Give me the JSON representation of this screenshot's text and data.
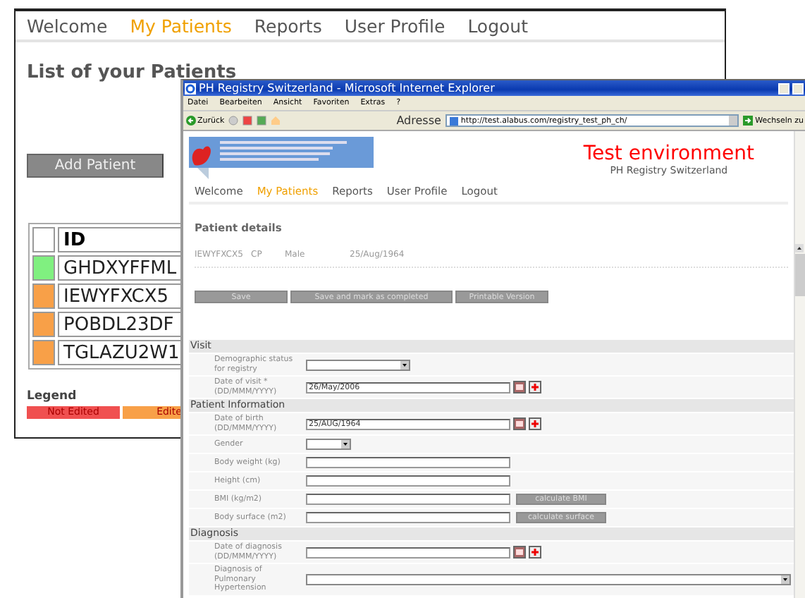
{
  "back_window": {
    "nav": [
      {
        "label": "Welcome",
        "selected": false
      },
      {
        "label": "My Patients",
        "selected": true
      },
      {
        "label": "Reports",
        "selected": false
      },
      {
        "label": "User Profile",
        "selected": false
      },
      {
        "label": "Logout",
        "selected": false
      }
    ],
    "heading": "List of your Patients",
    "add_button": "Add Patient",
    "table": {
      "columns": [
        "ID"
      ],
      "rows": [
        {
          "id": "GHDXYFFML",
          "color": "#80f080"
        },
        {
          "id": "IEWYFXCX5",
          "color": "#f8a048"
        },
        {
          "id": "POBDL23DF",
          "color": "#f8a048"
        },
        {
          "id": "TGLAZU2W1",
          "color": "#f8a048"
        }
      ]
    },
    "legend": {
      "title": "Legend",
      "items": [
        {
          "label": "Not Edited",
          "color": "#f05050"
        },
        {
          "label": "Edite",
          "color": "#f8a048"
        }
      ]
    }
  },
  "browser": {
    "title": "PH Registry Switzerland - Microsoft Internet Explorer",
    "menu": [
      "Datei",
      "Bearbeiten",
      "Ansicht",
      "Favoriten",
      "Extras",
      "?"
    ],
    "back_label": "Zurück",
    "address_label": "Adresse",
    "url": "http://test.alabus.com/registry_test_ph_ch/",
    "go_label": "Wechseln zu",
    "page": {
      "environment": "Test environment",
      "subtitle": "PH Registry Switzerland",
      "nav": [
        {
          "label": "Welcome",
          "selected": false
        },
        {
          "label": "My Patients",
          "selected": true
        },
        {
          "label": "Reports",
          "selected": false
        },
        {
          "label": "User Profile",
          "selected": false
        },
        {
          "label": "Logout",
          "selected": false
        }
      ],
      "section_title": "Patient details",
      "patient_info": [
        "IEWYFXCX5",
        "CP",
        "Male",
        "25/Aug/1964"
      ],
      "buttons": [
        "Save",
        "Save and mark as completed",
        "Printable Version"
      ],
      "form": [
        {
          "title": "Visit",
          "fields": [
            {
              "label": "Demographic status for registry",
              "kind": "select"
            },
            {
              "label": "Date of visit * (DD/MMM/YYYY)",
              "kind": "date",
              "value": "26/May/2006"
            }
          ]
        },
        {
          "title": "Patient Information",
          "fields": [
            {
              "label": "Date of birth (DD/MMM/YYYY)",
              "kind": "date",
              "value": "25/AUG/1964"
            },
            {
              "label": "Gender",
              "kind": "small_select"
            },
            {
              "label": "Body weight (kg)",
              "kind": "text"
            },
            {
              "label": "Height (cm)",
              "kind": "text"
            },
            {
              "label": "BMI (kg/m2)",
              "kind": "calc",
              "button": "calculate BMI"
            },
            {
              "label": "Body surface (m2)",
              "kind": "calc",
              "button": "calculate surface"
            }
          ]
        },
        {
          "title": "Diagnosis",
          "fields": [
            {
              "label": "Date of diagnosis (DD/MMM/YYYY)",
              "kind": "date"
            },
            {
              "label": "Diagnosis of Pulmonary Hypertension",
              "kind": "wide_select"
            }
          ]
        }
      ]
    }
  }
}
